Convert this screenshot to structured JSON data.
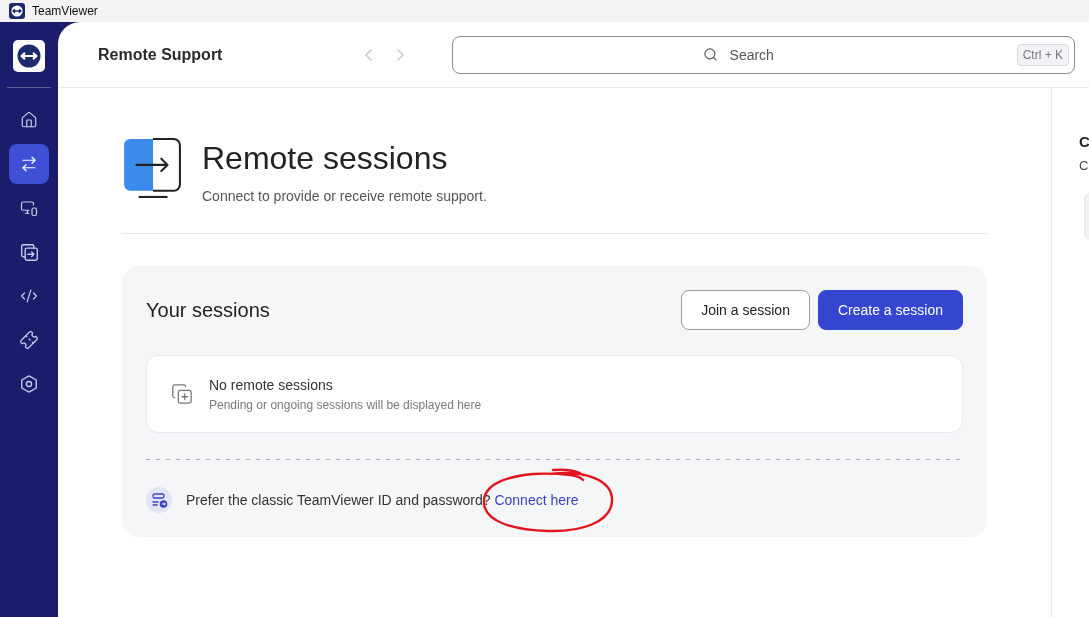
{
  "window": {
    "title": "TeamViewer"
  },
  "sidebar": {
    "items": [
      {
        "selected": false
      },
      {
        "selected": true
      },
      {
        "selected": false
      },
      {
        "selected": false
      },
      {
        "selected": false
      },
      {
        "selected": false
      },
      {
        "selected": false
      }
    ]
  },
  "header": {
    "title": "Remote Support",
    "nav": [
      {
        "kind": "back",
        "disabled": true
      },
      {
        "kind": "forward",
        "disabled": true
      }
    ],
    "search": {
      "placeholder": "Search",
      "shortcut": "Ctrl + K"
    }
  },
  "page": {
    "title": "Remote sessions",
    "subtitle": "Connect to provide or receive remote support."
  },
  "sessions": {
    "title": "Your sessions",
    "buttons": [
      {
        "label": "Join a session",
        "kind": "secondary"
      },
      {
        "label": "Create a session",
        "kind": "primary"
      }
    ],
    "empty_state": {
      "title": "No remote sessions",
      "text": "Pending or ongoing sessions will be displayed here"
    },
    "classic": {
      "text": "Prefer the classic TeamViewer ID and password?",
      "link": "Connect here",
      "annotation": {
        "kind": "circle"
      }
    }
  },
  "right_panel": {
    "title": "C",
    "subtitle": "C"
  }
}
